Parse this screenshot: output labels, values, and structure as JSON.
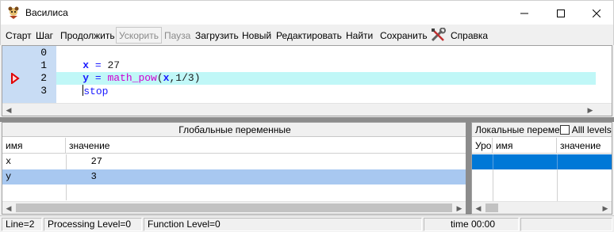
{
  "window": {
    "title": "Василиса",
    "minimize_label": "—",
    "maximize_label": "☐",
    "close_label": "✕"
  },
  "toolbar": {
    "items": [
      {
        "label": "Старт",
        "enabled": true
      },
      {
        "label": "Шаг",
        "enabled": true
      },
      {
        "label": "Продолжить",
        "enabled": true
      },
      {
        "label": "Ускорить",
        "enabled": false
      },
      {
        "label": "Пауза",
        "enabled": false
      },
      {
        "label": "Загрузить",
        "enabled": true
      },
      {
        "label": "Новый",
        "enabled": true
      },
      {
        "label": "Редактировать",
        "enabled": true
      },
      {
        "label": "Найти",
        "enabled": true
      },
      {
        "label": "Сохранить",
        "enabled": true
      },
      {
        "label": "Справка",
        "enabled": true
      }
    ]
  },
  "editor": {
    "line_numbers": [
      "0",
      "1",
      "2",
      "3"
    ],
    "current_line": 2,
    "lines": [
      {
        "tokens": [
          {
            "t": "x",
            "c": "kw"
          },
          {
            "t": " = ",
            "c": "op"
          },
          {
            "t": "27",
            "c": "num"
          }
        ]
      },
      {
        "tokens": [
          {
            "t": "y",
            "c": "kw"
          },
          {
            "t": " = ",
            "c": "op"
          },
          {
            "t": "math_pow",
            "c": "fn"
          },
          {
            "t": "(",
            "c": "num"
          },
          {
            "t": "x",
            "c": "kw"
          },
          {
            "t": ",1/3)",
            "c": "num"
          }
        ]
      },
      {
        "tokens": [
          {
            "t": "stop",
            "c": "txt-blue"
          }
        ]
      },
      {
        "tokens": []
      }
    ]
  },
  "globals_panel": {
    "title": "Глобальные переменные",
    "columns": [
      "имя",
      "значение"
    ],
    "rows": [
      {
        "name": "x",
        "value": "   27"
      },
      {
        "name": "y",
        "value": "   3"
      }
    ],
    "selected_row": 1
  },
  "locals_panel": {
    "title": "Локальные переме",
    "all_levels_label": "Alll levels",
    "all_levels_checked": false,
    "columns": [
      "Уро",
      "имя",
      "значение"
    ]
  },
  "statusbar": {
    "line": "Line=2",
    "processing_level": "Processing Level=0",
    "function_level": "Function Level=0",
    "time": "time 00:00"
  },
  "colors": {
    "current_line_bg": "#c0f7f7",
    "gutter_bg": "#c8dcf4",
    "selected_row_bg": "#a8c8f0",
    "focused_row_bg": "#0078d7",
    "breakpoint_arrow": "#e00000"
  }
}
